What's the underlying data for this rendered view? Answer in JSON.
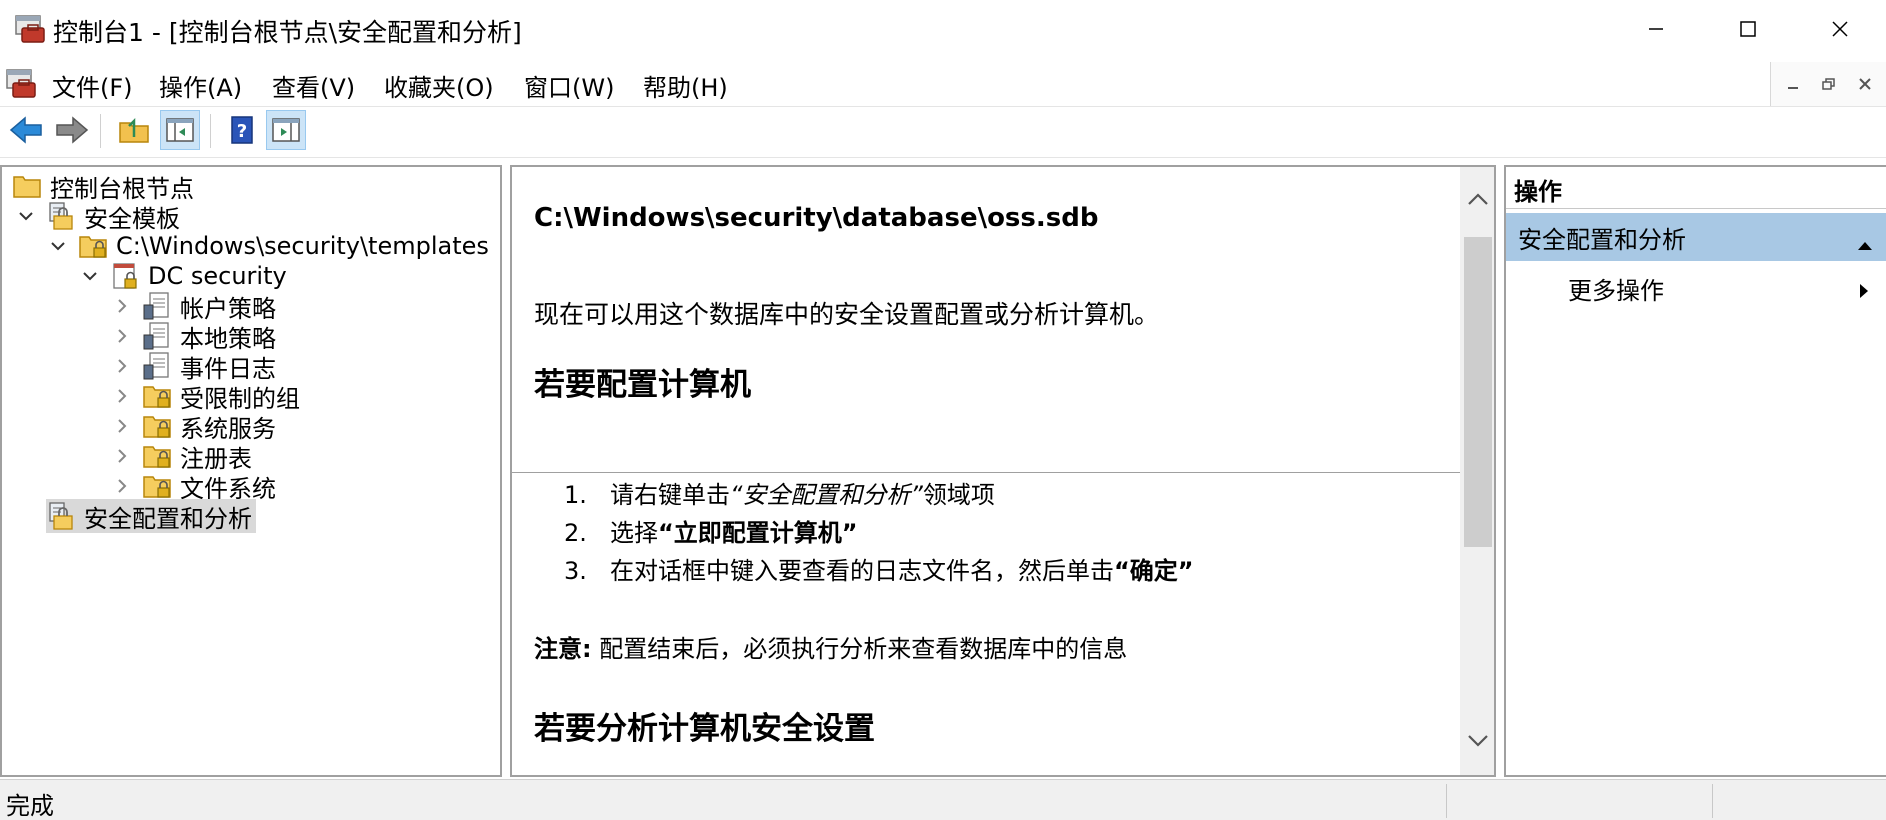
{
  "window": {
    "title": "控制台1 - [控制台根节点\\安全配置和分析]"
  },
  "menu": {
    "items": [
      "文件(F)",
      "操作(A)",
      "查看(V)",
      "收藏夹(O)",
      "窗口(W)",
      "帮助(H)"
    ]
  },
  "tree": {
    "root": "控制台根节点",
    "security_templates": "安全模板",
    "templates_path": "C:\\Windows\\security\\templates",
    "dc_security": "DC security",
    "children": [
      "帐户策略",
      "本地策略",
      "事件日志",
      "受限制的组",
      "系统服务",
      "注册表",
      "文件系统"
    ],
    "sca": "安全配置和分析"
  },
  "content": {
    "db_path": "C:\\Windows\\security\\database\\oss.sdb",
    "intro": "现在可以用这个数据库中的安全设置配置或分析计算机。",
    "h_configure": "若要配置计算机",
    "steps": [
      {
        "num": "1.",
        "pre": "请右键单击",
        "em": "“安全配置和分析”",
        "post": "领域项"
      },
      {
        "num": "2.",
        "pre": "选择",
        "strong": "“立即配置计算机”",
        "post": ""
      },
      {
        "num": "3.",
        "pre": "在对话框中键入要查看的日志文件名，然后单击",
        "strong": "“确定”",
        "post": ""
      }
    ],
    "note_label": "注意:",
    "note_text": " 配置结束后，必须执行分析来查看数据库中的信息",
    "h_analyze": "若要分析计算机安全设置"
  },
  "actions": {
    "header": "操作",
    "section": "安全配置和分析",
    "more": "更多操作"
  },
  "status": {
    "text": "完成"
  },
  "colors": {
    "selection_bg": "#d9d9d9",
    "actions_section_bg": "#a8c8e4",
    "toolbar_active": "#cce4f7"
  }
}
